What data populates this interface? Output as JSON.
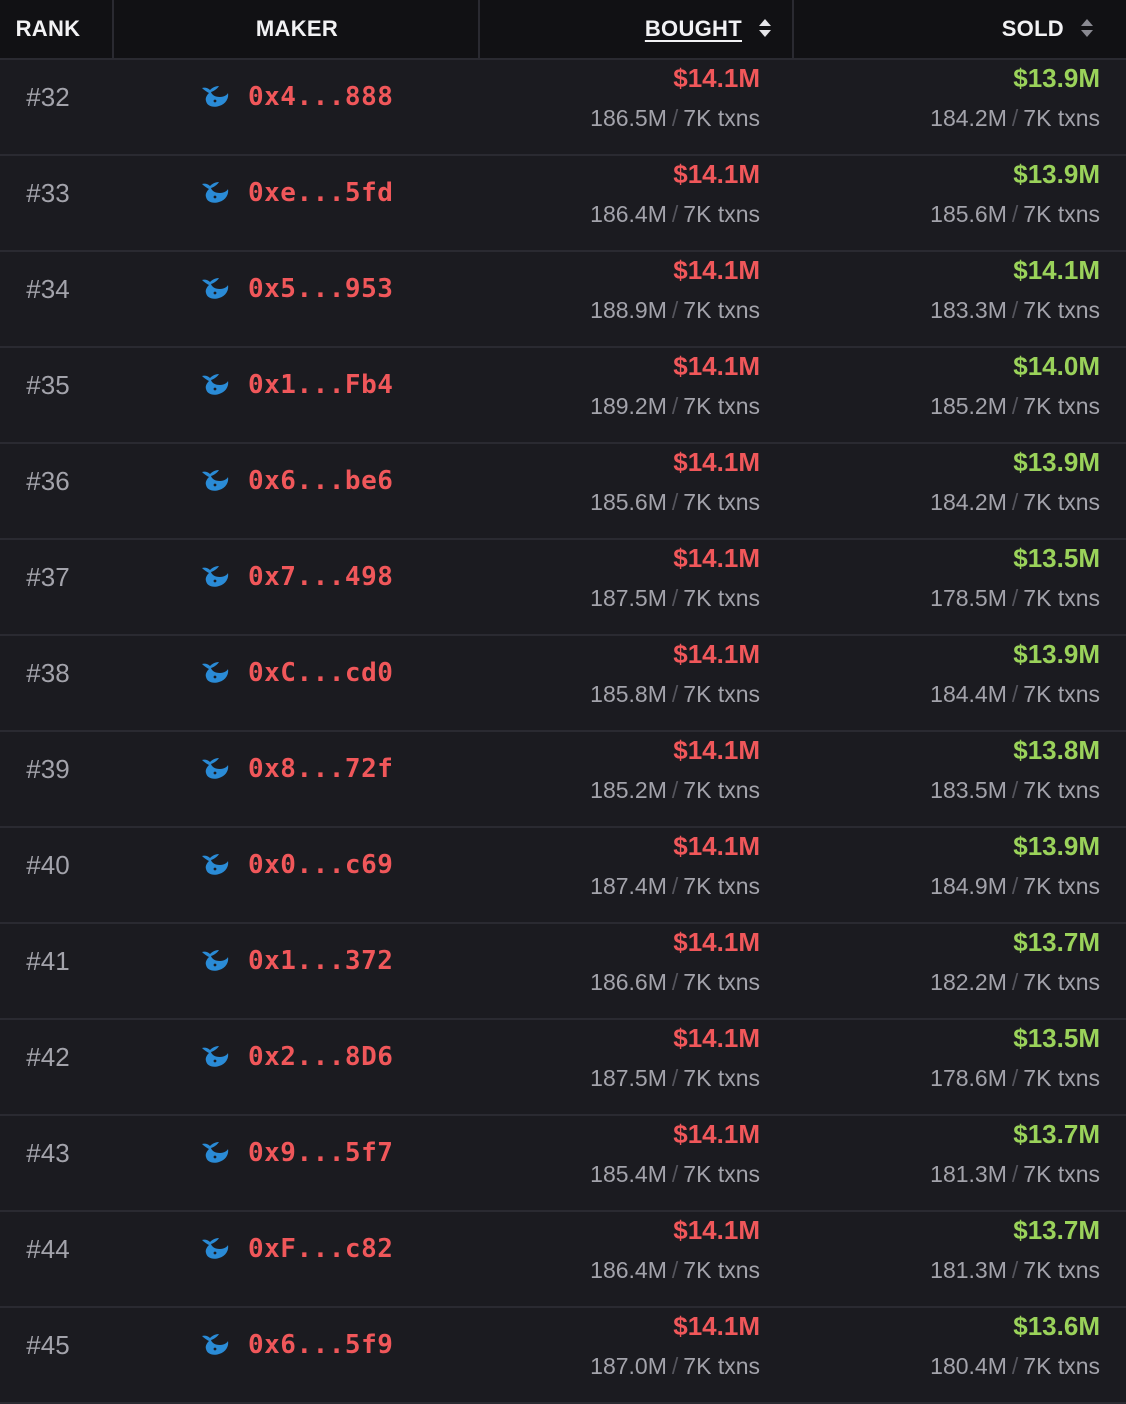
{
  "header": {
    "rank": "RANK",
    "maker": "MAKER",
    "bought": "BOUGHT",
    "sold": "SOLD"
  },
  "colors": {
    "background": "#1b1b20",
    "header_background": "#111114",
    "divider": "#2a2a31",
    "address": "#f0575a",
    "bought_amount": "#f0575a",
    "sold_amount": "#9ad25a",
    "whale_icon": "#2a8bd6",
    "muted_text": "#a3a3ab"
  },
  "icons": {
    "maker": "whale-icon",
    "sort": "sort-icon"
  },
  "rows": [
    {
      "rank": "#32",
      "maker": "0x4...888",
      "bought": "$14.1M",
      "bought_tokens": "186.5M",
      "bought_txns": "7K",
      "sold": "$13.9M",
      "sold_tokens": "184.2M",
      "sold_txns": "7K"
    },
    {
      "rank": "#33",
      "maker": "0xe...5fd",
      "bought": "$14.1M",
      "bought_tokens": "186.4M",
      "bought_txns": "7K",
      "sold": "$13.9M",
      "sold_tokens": "185.6M",
      "sold_txns": "7K"
    },
    {
      "rank": "#34",
      "maker": "0x5...953",
      "bought": "$14.1M",
      "bought_tokens": "188.9M",
      "bought_txns": "7K",
      "sold": "$14.1M",
      "sold_tokens": "183.3M",
      "sold_txns": "7K"
    },
    {
      "rank": "#35",
      "maker": "0x1...Fb4",
      "bought": "$14.1M",
      "bought_tokens": "189.2M",
      "bought_txns": "7K",
      "sold": "$14.0M",
      "sold_tokens": "185.2M",
      "sold_txns": "7K"
    },
    {
      "rank": "#36",
      "maker": "0x6...be6",
      "bought": "$14.1M",
      "bought_tokens": "185.6M",
      "bought_txns": "7K",
      "sold": "$13.9M",
      "sold_tokens": "184.2M",
      "sold_txns": "7K"
    },
    {
      "rank": "#37",
      "maker": "0x7...498",
      "bought": "$14.1M",
      "bought_tokens": "187.5M",
      "bought_txns": "7K",
      "sold": "$13.5M",
      "sold_tokens": "178.5M",
      "sold_txns": "7K"
    },
    {
      "rank": "#38",
      "maker": "0xC...cd0",
      "bought": "$14.1M",
      "bought_tokens": "185.8M",
      "bought_txns": "7K",
      "sold": "$13.9M",
      "sold_tokens": "184.4M",
      "sold_txns": "7K"
    },
    {
      "rank": "#39",
      "maker": "0x8...72f",
      "bought": "$14.1M",
      "bought_tokens": "185.2M",
      "bought_txns": "7K",
      "sold": "$13.8M",
      "sold_tokens": "183.5M",
      "sold_txns": "7K"
    },
    {
      "rank": "#40",
      "maker": "0x0...c69",
      "bought": "$14.1M",
      "bought_tokens": "187.4M",
      "bought_txns": "7K",
      "sold": "$13.9M",
      "sold_tokens": "184.9M",
      "sold_txns": "7K"
    },
    {
      "rank": "#41",
      "maker": "0x1...372",
      "bought": "$14.1M",
      "bought_tokens": "186.6M",
      "bought_txns": "7K",
      "sold": "$13.7M",
      "sold_tokens": "182.2M",
      "sold_txns": "7K"
    },
    {
      "rank": "#42",
      "maker": "0x2...8D6",
      "bought": "$14.1M",
      "bought_tokens": "187.5M",
      "bought_txns": "7K",
      "sold": "$13.5M",
      "sold_tokens": "178.6M",
      "sold_txns": "7K"
    },
    {
      "rank": "#43",
      "maker": "0x9...5f7",
      "bought": "$14.1M",
      "bought_tokens": "185.4M",
      "bought_txns": "7K",
      "sold": "$13.7M",
      "sold_tokens": "181.3M",
      "sold_txns": "7K"
    },
    {
      "rank": "#44",
      "maker": "0xF...c82",
      "bought": "$14.1M",
      "bought_tokens": "186.4M",
      "bought_txns": "7K",
      "sold": "$13.7M",
      "sold_tokens": "181.3M",
      "sold_txns": "7K"
    },
    {
      "rank": "#45",
      "maker": "0x6...5f9",
      "bought": "$14.1M",
      "bought_tokens": "187.0M",
      "bought_txns": "7K",
      "sold": "$13.6M",
      "sold_tokens": "180.4M",
      "sold_txns": "7K"
    }
  ]
}
